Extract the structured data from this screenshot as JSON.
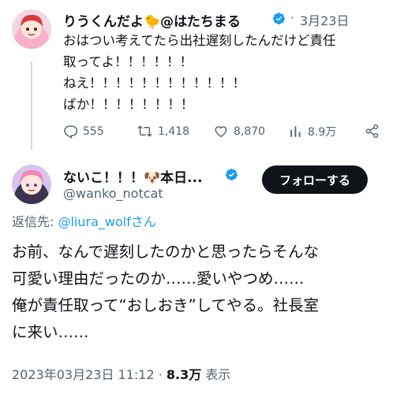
{
  "first_tweet": {
    "display_name": "りうくんだよ🐤@はたちまる",
    "date_sep": "·",
    "date": "3月23日",
    "lines": [
      "おはつい考えてたら出社遅刻したんだけど責任",
      "取ってよ！！！！！！",
      "ねえ！！！！！！！！！！！！",
      "ばか！！！！！！！！"
    ],
    "actions": {
      "replies": "555",
      "retweets": "1,418",
      "likes": "8,870",
      "views": "8.9万"
    }
  },
  "second_tweet": {
    "display_name": "ないこ！！！🐶本日...",
    "handle": "@wanko_notcat",
    "follow_label": "フォローする",
    "reply_prefix": "返信先: ",
    "reply_to": "@liura_wolfさん",
    "lines": [
      "お前、なんで遅刻したのかと思ったらそんな",
      "可愛い理由だったのか……愛いやつめ……",
      "俺が責任取って“おしおき”してやる。社長室",
      "に来い……"
    ],
    "timestamp": "2023年03月23日 11:12",
    "meta_sep": "·",
    "view_count": "8.3万",
    "view_label": "表示"
  },
  "colors": {
    "accent": "#1d9bf0",
    "muted": "#536471",
    "text": "#0f1419"
  }
}
